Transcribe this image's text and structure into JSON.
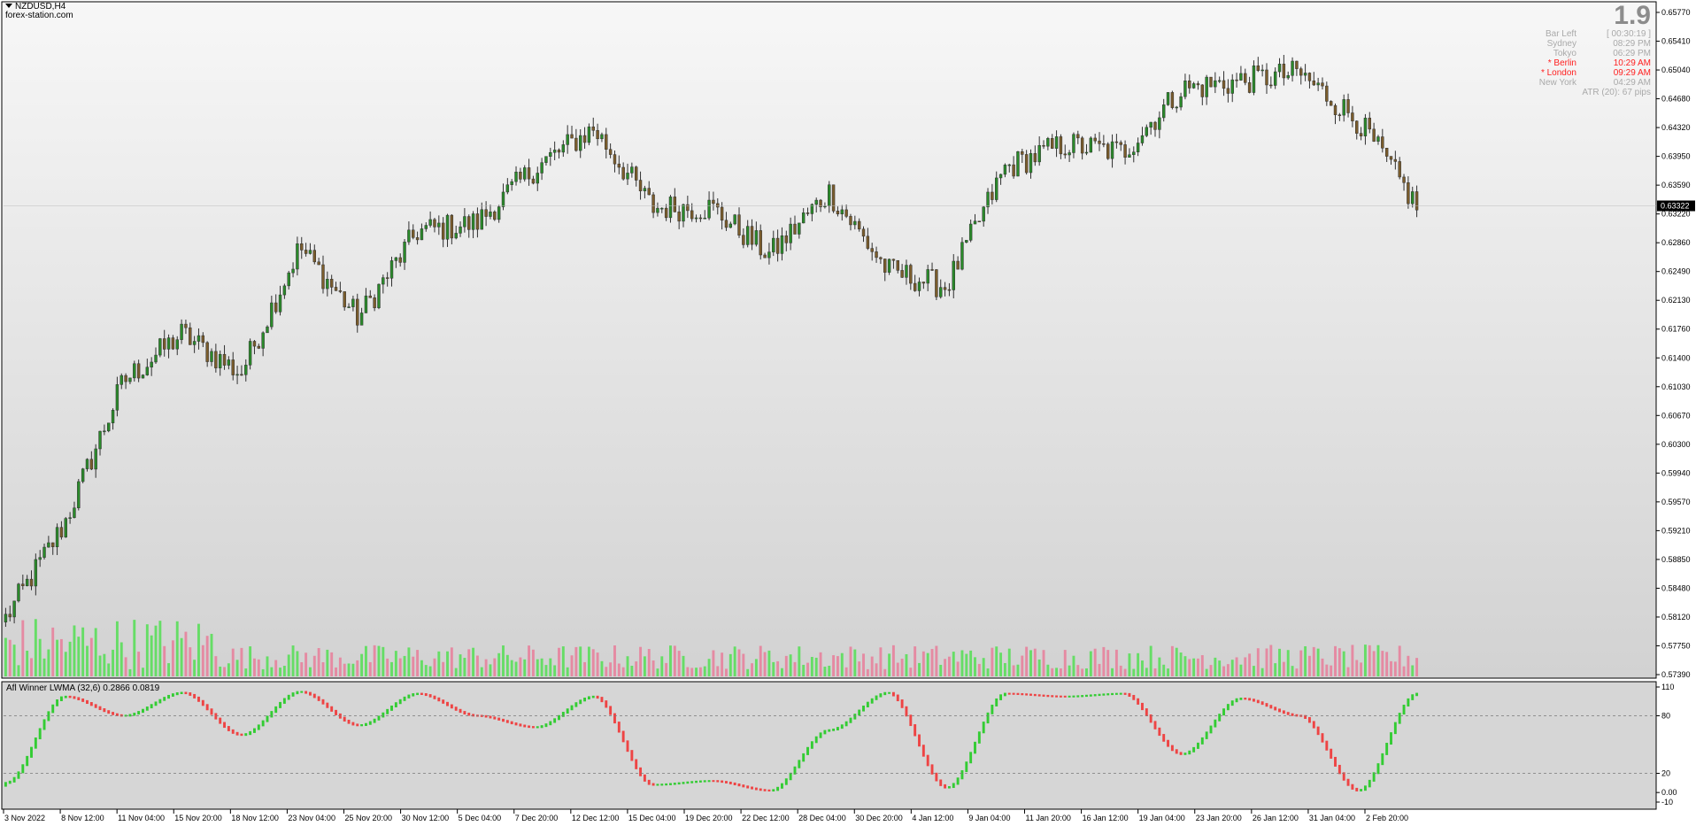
{
  "header": {
    "symbol_timeframe": "NZDUSD,H4",
    "watermark": "forex-station.com"
  },
  "info_panel": {
    "bar_count": "1.9",
    "rows": [
      {
        "label": "Bar Left",
        "value": "[ 00:30:19 ]",
        "highlight": false
      },
      {
        "label": "Sydney",
        "value": "08:29 PM",
        "highlight": false
      },
      {
        "label": "Tokyo",
        "value": "06:29 PM",
        "highlight": false
      },
      {
        "label": "* Berlin",
        "value": "10:29 AM",
        "highlight": true
      },
      {
        "label": "* London",
        "value": "09:29 AM",
        "highlight": true
      },
      {
        "label": "New York",
        "value": "04:29 AM",
        "highlight": false
      }
    ],
    "atr": "ATR (20): 67 pips"
  },
  "price_axis": {
    "ticks": [
      "0.65770",
      "0.65410",
      "0.65040",
      "0.64680",
      "0.64320",
      "0.63950",
      "0.63590",
      "0.63220",
      "0.62860",
      "0.62490",
      "0.62130",
      "0.61760",
      "0.61400",
      "0.61030",
      "0.60670",
      "0.60300",
      "0.59940",
      "0.59570",
      "0.59210",
      "0.58850",
      "0.58480",
      "0.58120",
      "0.57750",
      "0.57390"
    ],
    "current_price": "0.63322"
  },
  "indicator": {
    "label": "Afl Winner LWMA (32,6) 0.2866 0.0819",
    "axis_ticks": [
      "110",
      "80",
      "20",
      "0.00",
      "-10"
    ]
  },
  "time_axis": {
    "labels": [
      "3 Nov 2022",
      "8 Nov 12:00",
      "11 Nov 04:00",
      "15 Nov 20:00",
      "18 Nov 12:00",
      "23 Nov 04:00",
      "25 Nov 20:00",
      "30 Nov 12:00",
      "5 Dec 04:00",
      "7 Dec 20:00",
      "12 Dec 12:00",
      "15 Dec 04:00",
      "19 Dec 20:00",
      "22 Dec 12:00",
      "28 Dec 04:00",
      "30 Dec 20:00",
      "4 Jan 12:00",
      "9 Jan 04:00",
      "11 Jan 20:00",
      "16 Jan 12:00",
      "19 Jan 04:00",
      "23 Jan 20:00",
      "26 Jan 12:00",
      "31 Jan 04:00",
      "2 Feb 20:00"
    ]
  },
  "colors": {
    "bull_candle": "#2a8a2a",
    "bear_candle": "#7a5c2c",
    "wick": "#303030",
    "volume_up": "#66dd66",
    "volume_down": "#e58aa2",
    "indicator_up": "#33cc33",
    "indicator_down": "#ee4444",
    "gradient_top": "#f7f7f7",
    "gradient_bottom": "#d2d2d2"
  },
  "chart_data": {
    "type": "candlestick",
    "symbol": "NZDUSD",
    "timeframe": "H4",
    "x": [
      "3 Nov 2022",
      "8 Nov 12:00",
      "11 Nov 04:00",
      "15 Nov 20:00",
      "18 Nov 12:00",
      "23 Nov 04:00",
      "25 Nov 20:00",
      "30 Nov 12:00",
      "5 Dec 04:00",
      "7 Dec 20:00",
      "12 Dec 12:00",
      "15 Dec 04:00",
      "19 Dec 20:00",
      "22 Dec 12:00",
      "28 Dec 04:00",
      "30 Dec 20:00",
      "4 Jan 12:00",
      "9 Jan 04:00",
      "11 Jan 20:00",
      "16 Jan 12:00",
      "19 Jan 04:00",
      "23 Jan 20:00",
      "26 Jan 12:00",
      "31 Jan 04:00",
      "2 Feb 20:00"
    ],
    "close": [
      0.581,
      0.593,
      0.611,
      0.617,
      0.612,
      0.628,
      0.619,
      0.63,
      0.631,
      0.638,
      0.643,
      0.633,
      0.633,
      0.627,
      0.635,
      0.625,
      0.623,
      0.638,
      0.641,
      0.64,
      0.648,
      0.649,
      0.65,
      0.644,
      0.6332
    ],
    "ylim": [
      0.5739,
      0.6577
    ],
    "current_price": 0.63322,
    "indicator": {
      "name": "Afl Winner LWMA (32,6)",
      "values": [
        10,
        100,
        80,
        104,
        60,
        105,
        70,
        103,
        80,
        68,
        100,
        8,
        12,
        2,
        65,
        104,
        5,
        103,
        100,
        103,
        40,
        98,
        80,
        2,
        103
      ],
      "levels": [
        80,
        20
      ],
      "ylim": [
        -10,
        110
      ]
    }
  }
}
